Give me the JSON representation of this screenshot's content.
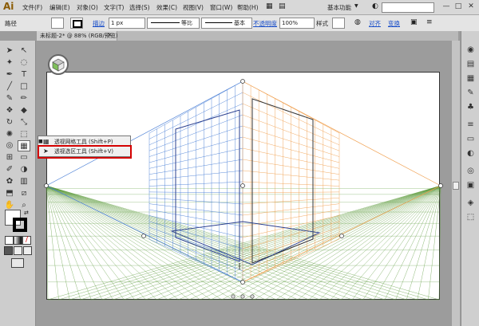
{
  "menubar": {
    "logo": "Ai",
    "items": [
      "文件(F)",
      "编辑(E)",
      "对象(O)",
      "文字(T)",
      "选择(S)",
      "效果(C)",
      "视图(V)",
      "窗口(W)",
      "帮助(H)"
    ],
    "workspace": "基本功能",
    "window_buttons": [
      "—",
      "□",
      "✕"
    ]
  },
  "controlbar": {
    "selection_label": "路径",
    "stroke_label": "描边",
    "stroke_weight": "1 px",
    "profile_label": "等比",
    "brush_label": "基本",
    "opacity_label": "不透明度",
    "opacity_value": "100%",
    "style_label": "样式",
    "align_label": "对齐",
    "transform_label": "变换"
  },
  "document": {
    "tab_title": "未标题-2* @ 88% (RGB/预览)"
  },
  "flyout": {
    "items": [
      {
        "label": "透视网格工具  (Shift+P)"
      },
      {
        "label": "透视选区工具  (Shift+V)"
      }
    ]
  },
  "icons": {
    "tools": [
      "selection-arrow",
      "direct-selection",
      "magic-wand",
      "lasso",
      "pen",
      "type",
      "line",
      "rectangle",
      "paintbrush",
      "pencil",
      "blob-brush",
      "eraser",
      "rotate",
      "scale",
      "warp",
      "free-transform",
      "shape-builder",
      "perspective-grid",
      "mesh",
      "gradient",
      "eyedropper",
      "blend",
      "symbol-sprayer",
      "column-graph",
      "artboard",
      "slice",
      "hand",
      "zoom"
    ],
    "right_panel": [
      "color",
      "color-guide",
      "swatches",
      "brushes",
      "symbols",
      "stroke",
      "gradient",
      "transparency",
      "appearance",
      "graphic-styles",
      "layers",
      "artboards"
    ]
  },
  "colors": {
    "left_grid": "#4a7fd6",
    "right_grid": "#f0a050",
    "ground_grid": "#5a9a3a",
    "highlight": "#d40000"
  }
}
